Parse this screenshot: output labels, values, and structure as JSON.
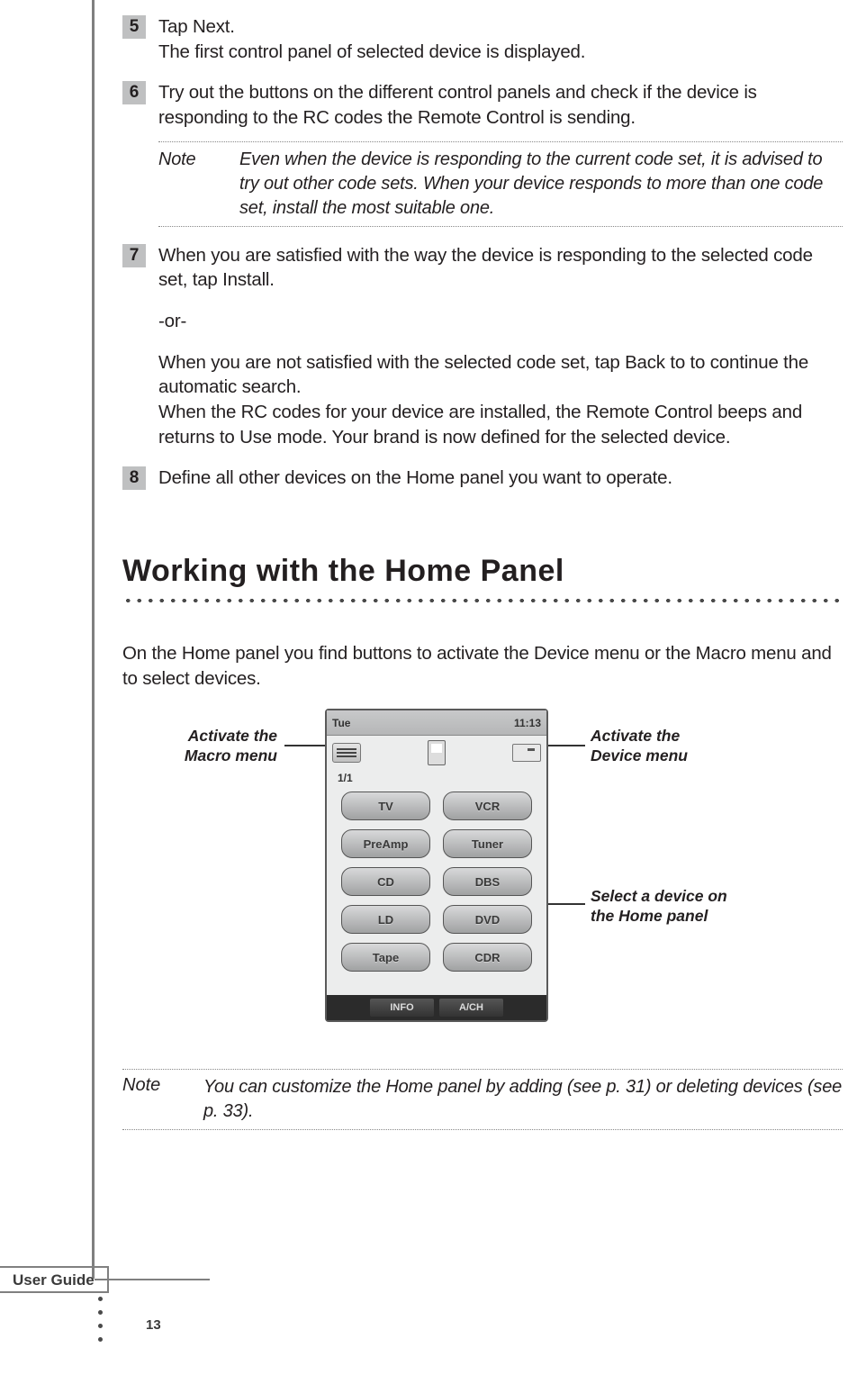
{
  "steps": {
    "s5": {
      "num": "5",
      "heading": "Tap Next.",
      "body": "The first control panel of selected device is displayed."
    },
    "s6": {
      "num": "6",
      "body": "Try out the buttons on the different control panels and check if the device is responding to the RC codes the Remote Control is sending."
    },
    "note1": {
      "label": "Note",
      "text": "Even when the device is responding to the current code set, it is advised to try out other code sets. When your device responds to more than one code set, install the most suitable one."
    },
    "s7": {
      "num": "7",
      "p1": "When you are satisfied with the way the device is responding to the selected code set, tap Install.",
      "or": "-or-",
      "p2": "When you are not satisfied with the selected code set, tap Back to to continue the automatic search.",
      "p3": "When the RC codes for your device are installed, the Remote Control beeps and returns to Use mode. Your brand is now defined for the selected device."
    },
    "s8": {
      "num": "8",
      "body": "Define all other devices on the Home panel you want to operate."
    }
  },
  "section_title": "Working with the Home Panel",
  "intro": "On the Home panel you find buttons to activate the Device menu or the Macro menu and to select devices.",
  "device": {
    "day": "Tue",
    "time": "11:13",
    "page": "1/1",
    "buttons": [
      "TV",
      "VCR",
      "PreAmp",
      "Tuner",
      "CD",
      "DBS",
      "LD",
      "DVD",
      "Tape",
      "CDR"
    ],
    "footer": [
      "INFO",
      "A/CH"
    ]
  },
  "callouts": {
    "macro": "Activate the Macro menu",
    "devmenu": "Activate the Device menu",
    "select": "Select a device on the Home panel"
  },
  "note2": {
    "label": "Note",
    "text": "You can customize the Home panel by adding (see p. 31) or deleting devices (see p. 33)."
  },
  "footer": {
    "tab": "User Guide",
    "page": "13"
  }
}
